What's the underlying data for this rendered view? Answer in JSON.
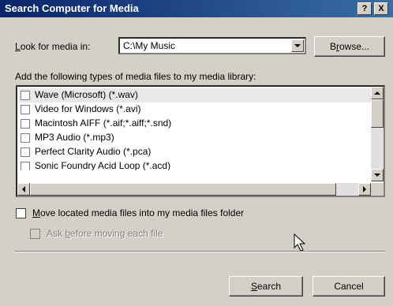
{
  "title": "Search Computer for Media",
  "titlebar": {
    "help": "?",
    "close": "X"
  },
  "look_for": {
    "label_pre": "",
    "label_key": "L",
    "label_post": "ook for media in:",
    "value": "C:\\My Music",
    "browse_pre": "B",
    "browse_key": "r",
    "browse_post": "owse..."
  },
  "types_label": "Add the following types of media files to my media library:",
  "media_types": [
    "Wave (Microsoft) (*.wav)",
    "Video for Windows (*.avi)",
    "Macintosh AIFF (*.aif;*.aiff;*.snd)",
    "MP3 Audio (*.mp3)",
    "Perfect Clarity Audio (*.pca)",
    "Sonic Foundry Acid Loop (*.acd)"
  ],
  "move_option": {
    "key": "M",
    "rest": "ove located media files into my media files folder"
  },
  "ask_option": {
    "pre": "Ask ",
    "key": "b",
    "rest": "efore moving each file"
  },
  "buttons": {
    "search_key": "S",
    "search_rest": "earch",
    "cancel": "Cancel"
  }
}
